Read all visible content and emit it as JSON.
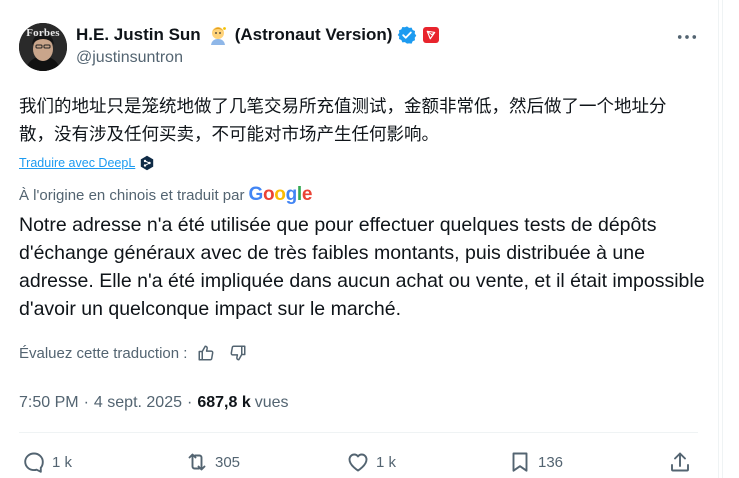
{
  "author": {
    "display_name": "H.E. Justin Sun",
    "name_suffix": "(Astronaut Version)",
    "handle": "@justinsuntron",
    "avatar_text": "Forbes"
  },
  "tweet": {
    "original_text": "我们的地址只是笼统地做了几笔交易所充值测试，金额非常低，然后做了一个地址分散，没有涉及任何买卖，不可能对市场产生任何影响。",
    "translate_link": "Traduire avec DeepL",
    "origin_label": "À l'origine en chinois et traduit par",
    "google_word": [
      "G",
      "o",
      "o",
      "g",
      "l",
      "e"
    ],
    "translated_text": "Notre adresse n'a été utilisée que pour effectuer quelques tests de dépôts d'échange généraux avec de très faibles montants, puis distribuée à une adresse. Elle n'a été impliquée dans aucun achat ou vente, et il était impossible d'avoir un quelconque impact sur le marché.",
    "rate_label": "Évaluez cette traduction :",
    "time": "7:50 PM",
    "separator": "·",
    "date": "4 sept. 2025",
    "views_count": "687,8 k",
    "views_label": "vues"
  },
  "actions": {
    "replies": "1 k",
    "reposts": "305",
    "likes": "1 k",
    "bookmarks": "136"
  },
  "colors": {
    "accent": "#1d9bf0",
    "secondary_text": "#536471",
    "google": [
      "#4285F4",
      "#EA4335",
      "#FBBC05",
      "#4285F4",
      "#34A853",
      "#EA4335"
    ]
  },
  "icons": {
    "more": "more-dots-icon",
    "verified": "verified-badge-icon",
    "affiliate": "affiliate-badge-icon",
    "deepl": "deepl-icon",
    "thumbs_up": "thumbs-up-icon",
    "thumbs_down": "thumbs-down-icon",
    "reply": "reply-icon",
    "repost": "repost-icon",
    "like": "heart-icon",
    "bookmark": "bookmark-icon",
    "share": "share-icon"
  }
}
